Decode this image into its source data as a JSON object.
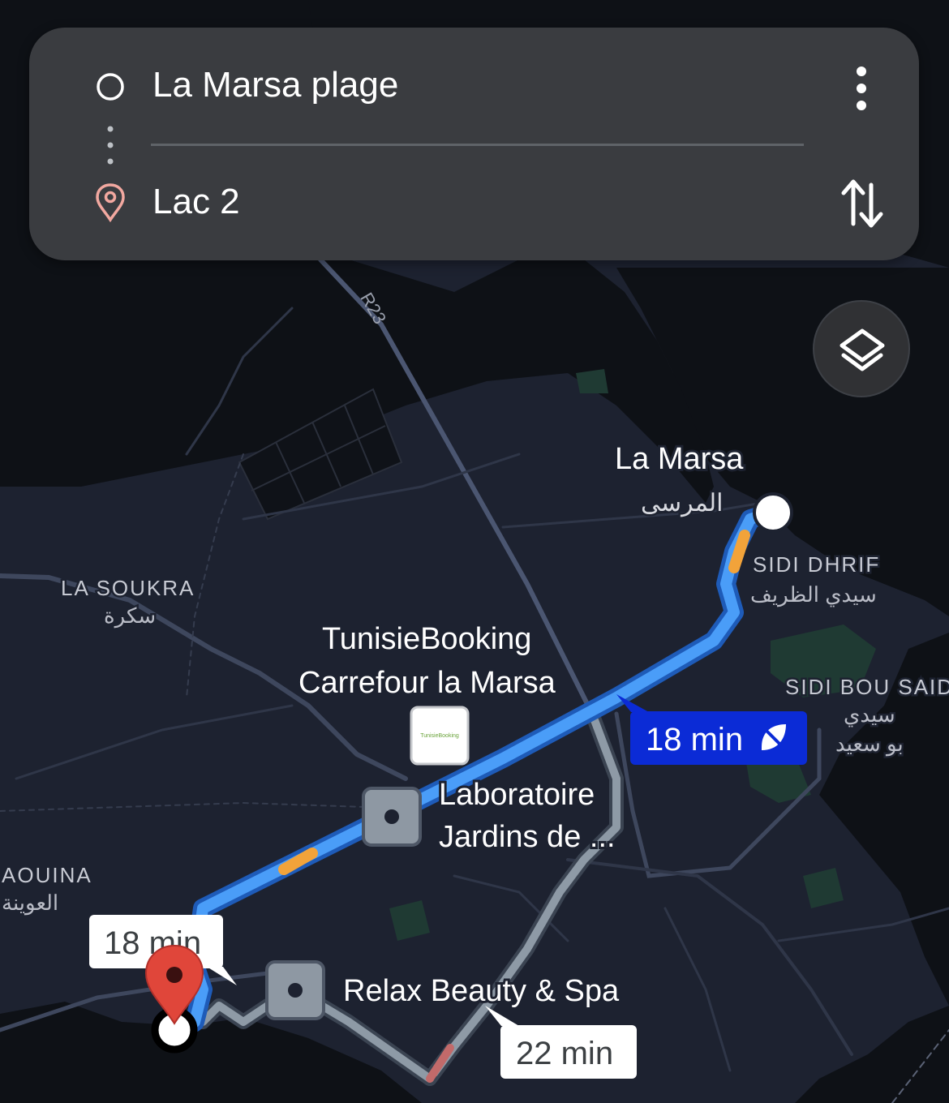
{
  "search": {
    "origin": "La Marsa plage",
    "destination": "Lac 2"
  },
  "map": {
    "road_label": "R23",
    "places": {
      "la_marsa": "La Marsa",
      "la_marsa_ar": "المرسى",
      "sidi_dhrif": "SIDI DHRIF",
      "sidi_dhrif_ar": "سيدي الظريف",
      "sidi_bou_said": "SIDI BOU SAID",
      "sidi_bou_said_ar_1": "سيدي",
      "sidi_bou_said_ar_2": "بو سعيد",
      "la_soukra": "LA SOUKRA",
      "la_soukra_ar": "سكرة",
      "aouina": "AOUINA",
      "aouina_ar": "العوينة"
    },
    "pois": {
      "tunisiebooking_line1": "TunisieBooking",
      "tunisiebooking_line2": "Carrefour la Marsa",
      "tunisiebooking_logo": "TunisieBooking",
      "laboratoire_line1": "Laboratoire",
      "laboratoire_line2": "Jardins de ...",
      "relax": "Relax Beauty & Spa"
    },
    "route_times": {
      "primary": "18 min",
      "alt_start": "18 min",
      "alt_2": "22 min"
    }
  },
  "colors": {
    "route_primary": "#4a9df8",
    "route_traffic": "#f2a33a",
    "route_alt": "#8e9aa6",
    "selected_chip": "#0b2bd6",
    "destination_pin": "#e0463a"
  },
  "icons": {
    "origin": "circle-outline-icon",
    "destination": "location-pin-icon",
    "more": "more-vert-icon",
    "swap": "swap-vert-icon",
    "layers": "layers-icon",
    "eco": "leaf-icon"
  }
}
